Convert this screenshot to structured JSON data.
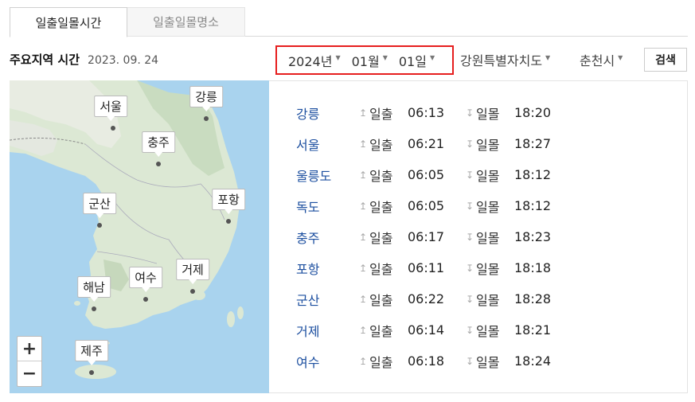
{
  "tabs": [
    {
      "label": "일출일몰시간"
    },
    {
      "label": "일출일몰명소"
    }
  ],
  "heading": {
    "title": "주요지역 시간",
    "date": "2023. 09. 24"
  },
  "controls": {
    "year": "2024년",
    "month": "01월",
    "day": "01일",
    "province": "강원특별자치도",
    "city": "춘천시",
    "search_label": "검색"
  },
  "map": {
    "pins": [
      "서울",
      "강릉",
      "충주",
      "군산",
      "포항",
      "거제",
      "여수",
      "해남",
      "제주"
    ],
    "zoom_in": "+",
    "zoom_out": "−"
  },
  "labels": {
    "sunrise": "일출",
    "sunset": "일몰",
    "up_arrow": "↥",
    "down_arrow": "↧"
  },
  "rows": [
    {
      "city": "강릉",
      "sunrise": "06:13",
      "sunset": "18:20"
    },
    {
      "city": "서울",
      "sunrise": "06:21",
      "sunset": "18:27"
    },
    {
      "city": "울릉도",
      "sunrise": "06:05",
      "sunset": "18:12"
    },
    {
      "city": "독도",
      "sunrise": "06:05",
      "sunset": "18:12"
    },
    {
      "city": "충주",
      "sunrise": "06:17",
      "sunset": "18:23"
    },
    {
      "city": "포항",
      "sunrise": "06:11",
      "sunset": "18:18"
    },
    {
      "city": "군산",
      "sunrise": "06:22",
      "sunset": "18:28"
    },
    {
      "city": "거제",
      "sunrise": "06:14",
      "sunset": "18:21"
    },
    {
      "city": "여수",
      "sunrise": "06:18",
      "sunset": "18:24"
    }
  ],
  "colors": {
    "highlight_border": "#e61e1e",
    "city_link": "#1e50a0",
    "sea": "#a9d3ee",
    "land": "#dce8d4"
  }
}
